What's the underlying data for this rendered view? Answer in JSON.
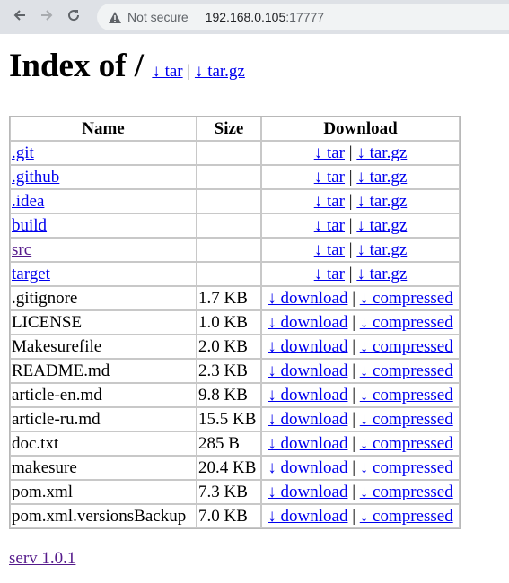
{
  "browser": {
    "security_label": "Not secure",
    "url_host": "192.168.0.105",
    "url_port": ":17777"
  },
  "page": {
    "title": "Index of /",
    "title_links": {
      "tar": "↓ tar",
      "sep": "|",
      "targz": "↓ tar.gz"
    },
    "table": {
      "headers": {
        "name": "Name",
        "size": "Size",
        "download": "Download"
      },
      "dirs": [
        {
          "name": ".git",
          "visited": false
        },
        {
          "name": ".github",
          "visited": false
        },
        {
          "name": ".idea",
          "visited": false
        },
        {
          "name": "build",
          "visited": false
        },
        {
          "name": "src",
          "visited": true
        },
        {
          "name": "target",
          "visited": false
        }
      ],
      "dir_links": {
        "tar": "↓ tar",
        "sep": "|",
        "targz": "↓ tar.gz"
      },
      "files": [
        {
          "name": ".gitignore",
          "size": "1.7 KB"
        },
        {
          "name": "LICENSE",
          "size": "1.0 KB"
        },
        {
          "name": "Makesurefile",
          "size": "2.0 KB"
        },
        {
          "name": "README.md",
          "size": "2.3 KB"
        },
        {
          "name": "article-en.md",
          "size": "9.8 KB"
        },
        {
          "name": "article-ru.md",
          "size": "15.5 KB"
        },
        {
          "name": "doc.txt",
          "size": "285 B"
        },
        {
          "name": "makesure",
          "size": "20.4 KB"
        },
        {
          "name": "pom.xml",
          "size": "7.3 KB"
        },
        {
          "name": "pom.xml.versionsBackup",
          "size": "7.0 KB"
        }
      ],
      "file_links": {
        "download": "↓ download",
        "sep": "|",
        "compressed": "↓ compressed"
      }
    },
    "footer": "serv 1.0.1"
  },
  "colors": {
    "link": "#0000ee",
    "visited": "#551a8b",
    "chrome": "#dee1e6",
    "omnibox": "#f1f3f4"
  },
  "icons": [
    "back-arrow-icon",
    "forward-arrow-icon",
    "reload-icon",
    "warning-triangle-icon"
  ]
}
